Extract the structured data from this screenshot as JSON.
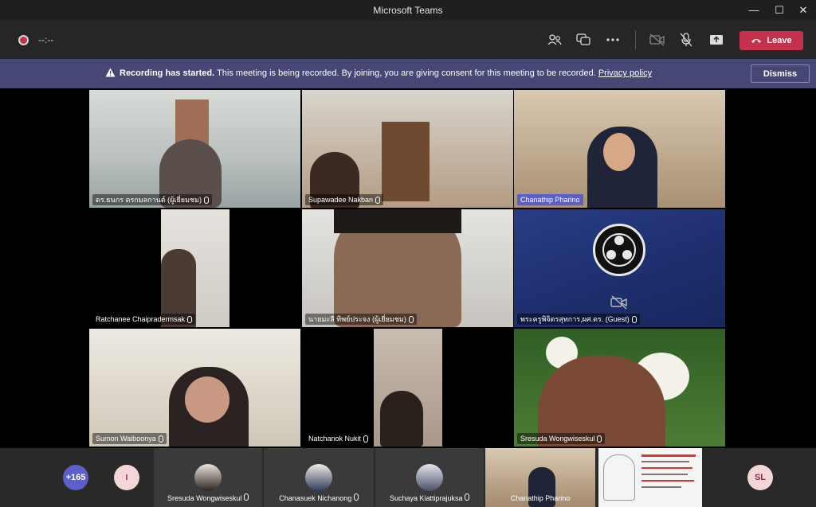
{
  "app": {
    "window_title": "Microsoft Teams",
    "controls": {
      "minimize": "—",
      "maximize": "☐",
      "close": "✕"
    }
  },
  "toolbar": {
    "timer": "--:--",
    "leave_label": "Leave",
    "icons": [
      "people-icon",
      "chat-icon",
      "more-icon",
      "camera-off-icon",
      "mic-off-icon",
      "share-icon"
    ]
  },
  "banner": {
    "title": "Recording has started.",
    "message": "This meeting is being recorded. By joining, you are giving consent for this meeting to be recorded.",
    "link": "Privacy policy",
    "dismiss_label": "Dismiss"
  },
  "participants": [
    {
      "name": "ดร.ธนกร ดรกมลกานต์ (ผู้เยี่ยมชม)",
      "active": false,
      "bg": "#bfc7c6"
    },
    {
      "name": "Supawadee Nakban",
      "active": false,
      "bg": "#a68c74"
    },
    {
      "name": "Chanathip Pharino",
      "active": true,
      "bg": "#b59f86"
    },
    {
      "name": "Ratchanee Chaipradermsak",
      "active": false,
      "bg": "#0a0a0a"
    },
    {
      "name": "นายมะลี ทิพย์ประจง (ผู้เยี่ยมชม)",
      "active": false,
      "bg": "#9a8d81"
    },
    {
      "name": "พระครูพิจิตรสุทการ,ผศ.ดร. (Guest)",
      "active": false,
      "bg": "#1d2f6e"
    },
    {
      "name": "Sumon Waiboonya",
      "active": false,
      "bg": "#d8d2c6"
    },
    {
      "name": "Natchanok Nukit",
      "active": false,
      "bg": "#0a0a0a"
    },
    {
      "name": "Sresuda Wongwiseskul",
      "active": false,
      "bg": "#3f6b2b"
    }
  ],
  "bottom": {
    "overflow_count": "+165",
    "initial_avatar": "I",
    "thumbs": [
      {
        "name": "Sresuda Wongwiseskul"
      },
      {
        "name": "Chanasuek Nichanong"
      },
      {
        "name": "Suchaya Kiattiprajuksa"
      },
      {
        "name": "Chanathip Pharino"
      }
    ],
    "right_avatar": "SL"
  },
  "colors": {
    "accent": "#5b5fc7",
    "leave": "#c4314b",
    "banner": "#464775"
  }
}
